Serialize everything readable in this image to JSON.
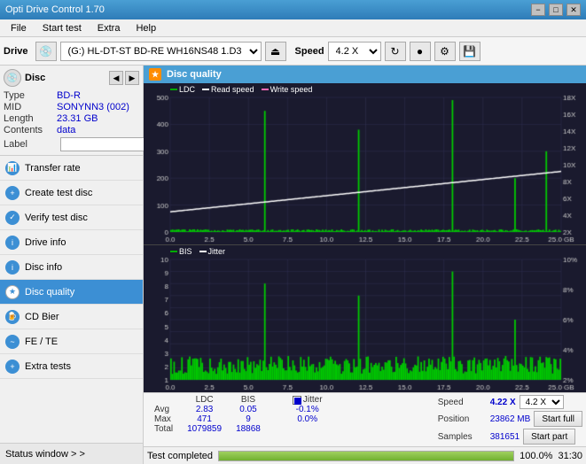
{
  "app": {
    "title": "Opti Drive Control 1.70",
    "titlebar_buttons": [
      "−",
      "□",
      "✕"
    ]
  },
  "menubar": {
    "items": [
      "File",
      "Start test",
      "Extra",
      "Help"
    ]
  },
  "toolbar": {
    "drive_label": "Drive",
    "drive_value": "(G:)  HL-DT-ST BD-RE  WH16NS48 1.D3",
    "speed_label": "Speed",
    "speed_value": "4.2 X"
  },
  "disc": {
    "title": "Disc",
    "type_label": "Type",
    "type_value": "BD-R",
    "mid_label": "MID",
    "mid_value": "SONYNN3 (002)",
    "length_label": "Length",
    "length_value": "23.31 GB",
    "contents_label": "Contents",
    "contents_value": "data",
    "label_label": "Label"
  },
  "nav": {
    "items": [
      {
        "id": "transfer-rate",
        "label": "Transfer rate",
        "active": false
      },
      {
        "id": "create-test-disc",
        "label": "Create test disc",
        "active": false
      },
      {
        "id": "verify-test-disc",
        "label": "Verify test disc",
        "active": false
      },
      {
        "id": "drive-info",
        "label": "Drive info",
        "active": false
      },
      {
        "id": "disc-info",
        "label": "Disc info",
        "active": false
      },
      {
        "id": "disc-quality",
        "label": "Disc quality",
        "active": true
      },
      {
        "id": "cd-bier",
        "label": "CD Bier",
        "active": false
      },
      {
        "id": "fe-te",
        "label": "FE / TE",
        "active": false
      },
      {
        "id": "extra-tests",
        "label": "Extra tests",
        "active": false
      }
    ]
  },
  "status_window": {
    "label": "Status window > >"
  },
  "progress": {
    "value": 100,
    "text": "Test completed",
    "time": "31:30"
  },
  "disc_quality": {
    "title": "Disc quality",
    "chart1": {
      "legend": [
        {
          "label": "LDC",
          "color": "#00aa00"
        },
        {
          "label": "Read speed",
          "color": "#ffffff"
        },
        {
          "label": "Write speed",
          "color": "#ff69b4"
        }
      ],
      "y_left": [
        "500",
        "400",
        "300",
        "200",
        "100",
        "0"
      ],
      "y_right": [
        "18X",
        "16X",
        "14X",
        "12X",
        "10X",
        "8X",
        "6X",
        "4X",
        "2X"
      ],
      "x_axis": [
        "0.0",
        "2.5",
        "5.0",
        "7.5",
        "10.0",
        "12.5",
        "15.0",
        "17.5",
        "20.0",
        "22.5",
        "25.0 GB"
      ]
    },
    "chart2": {
      "legend": [
        {
          "label": "BIS",
          "color": "#00aa00"
        },
        {
          "label": "Jitter",
          "color": "#ffffff"
        }
      ],
      "y_left": [
        "10",
        "9",
        "8",
        "7",
        "6",
        "5",
        "4",
        "3",
        "2",
        "1"
      ],
      "y_right": [
        "10%",
        "8%",
        "6%",
        "4%",
        "2%"
      ],
      "x_axis": [
        "0.0",
        "2.5",
        "5.0",
        "7.5",
        "10.0",
        "12.5",
        "15.0",
        "17.5",
        "20.0",
        "22.5",
        "25.0 GB"
      ]
    },
    "stats": {
      "headers": [
        "LDC",
        "BIS",
        "",
        "Jitter",
        "Speed",
        ""
      ],
      "avg_label": "Avg",
      "avg_ldc": "2.83",
      "avg_bis": "0.05",
      "avg_jitter": "-0.1%",
      "max_label": "Max",
      "max_ldc": "471",
      "max_bis": "9",
      "max_jitter": "0.0%",
      "total_label": "Total",
      "total_ldc": "1079859",
      "total_bis": "18868",
      "speed_label": "Speed",
      "speed_value": "4.22 X",
      "position_label": "Position",
      "position_value": "23862 MB",
      "samples_label": "Samples",
      "samples_value": "381651",
      "jitter_checked": true,
      "speed_selector": "4.2 X",
      "btn_start_full": "Start full",
      "btn_start_part": "Start part"
    }
  }
}
